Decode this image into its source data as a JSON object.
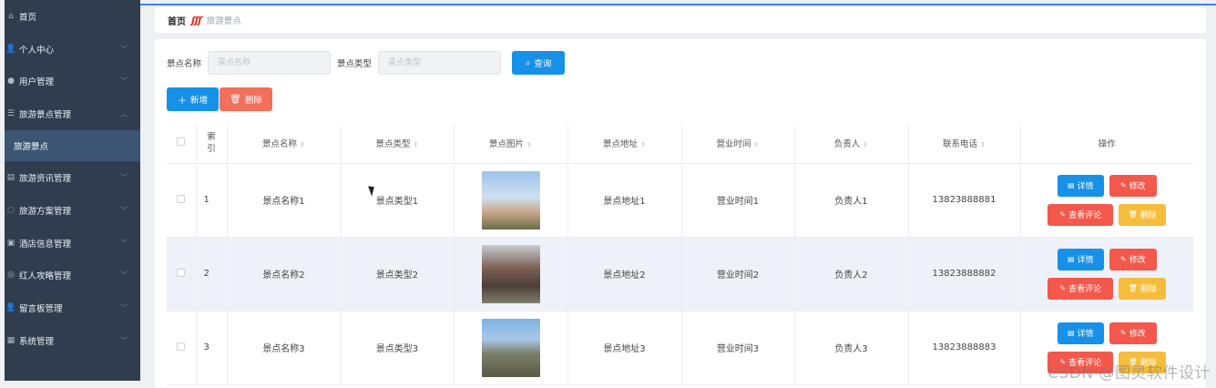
{
  "sidebar": {
    "items": [
      {
        "label": "首页",
        "icon": "home-icon",
        "glyph": "⌂",
        "chev": ""
      },
      {
        "label": "个人中心",
        "icon": "user-icon",
        "glyph": "👤",
        "chev": "﹀"
      },
      {
        "label": "用户管理",
        "icon": "users-icon",
        "glyph": "●",
        "chev": "﹀"
      },
      {
        "label": "旅游景点管理",
        "icon": "list-icon",
        "glyph": "☰",
        "chev": "︿"
      }
    ],
    "active_sub": "旅游景点",
    "items_after": [
      {
        "label": "旅游资讯管理",
        "icon": "news-icon",
        "glyph": "▤",
        "chev": "﹀"
      },
      {
        "label": "旅游方案管理",
        "icon": "plan-icon",
        "glyph": "◌",
        "chev": "﹀"
      },
      {
        "label": "酒店信息管理",
        "icon": "hotel-icon",
        "glyph": "▣",
        "chev": "﹀"
      },
      {
        "label": "红人攻略管理",
        "icon": "guide-icon",
        "glyph": "◎",
        "chev": "﹀"
      },
      {
        "label": "留言板管理",
        "icon": "message-icon",
        "glyph": "👤",
        "chev": "﹀"
      },
      {
        "label": "系统管理",
        "icon": "system-icon",
        "glyph": "▦",
        "chev": "﹀"
      }
    ]
  },
  "breadcrumb": {
    "home": "首页",
    "separator": "ʃʃʃ",
    "current": "旅游景点"
  },
  "search": {
    "name_label": "景点名称",
    "name_placeholder": "景点名称",
    "type_label": "景点类型",
    "type_placeholder": "景点类型",
    "query_label": "查询"
  },
  "toolbar": {
    "add_label": "新增",
    "delete_label": "删除"
  },
  "table": {
    "headers": {
      "index": "索\n引",
      "name": "景点名称",
      "type": "景点类型",
      "image": "景点图片",
      "address": "景点地址",
      "hours": "营业时间",
      "manager": "负责人",
      "phone": "联系电话",
      "ops": "操作"
    },
    "rows": [
      {
        "index": "1",
        "name": "景点名称1",
        "type": "景点类型1",
        "address": "景点地址1",
        "hours": "营业时间1",
        "manager": "负责人1",
        "phone": "13823888881"
      },
      {
        "index": "2",
        "name": "景点名称2",
        "type": "景点类型2",
        "address": "景点地址2",
        "hours": "营业时间2",
        "manager": "负责人2",
        "phone": "13823888882"
      },
      {
        "index": "3",
        "name": "景点名称3",
        "type": "景点类型3",
        "address": "景点地址3",
        "hours": "营业时间3",
        "manager": "负责人3",
        "phone": "13823888883"
      }
    ],
    "ops": {
      "detail": "详情",
      "edit": "修改",
      "review": "查看评论",
      "delete": "删除"
    }
  },
  "watermark": "CSDN @图灵软件设计",
  "colors": {
    "sidebar_bg": "#2f3d4f",
    "primary": "#1790e8",
    "danger": "#f4574b",
    "warning": "#f6bd3c",
    "row_stripe": "#eef2f8"
  }
}
